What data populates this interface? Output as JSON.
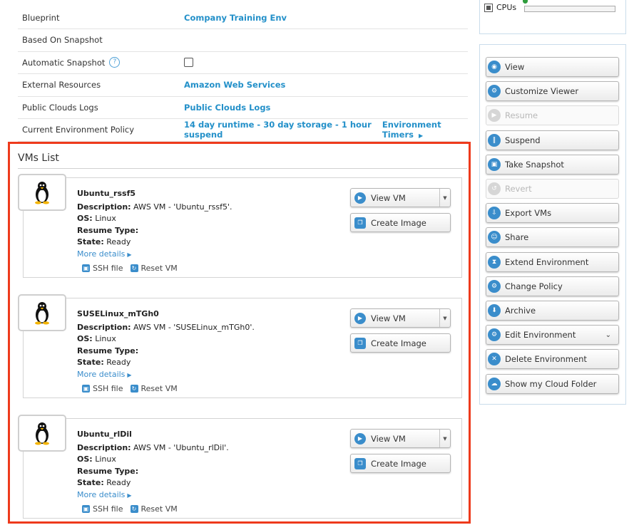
{
  "properties": [
    {
      "label": "Blueprint",
      "value": "Company Training Env"
    },
    {
      "label": "Based On Snapshot",
      "value": ""
    },
    {
      "label": "Automatic Snapshot",
      "value": ""
    },
    {
      "label": "External Resources",
      "value": "Amazon Web Services"
    },
    {
      "label": "Public Clouds Logs",
      "value": "Public Clouds Logs"
    },
    {
      "label": "Current Environment Policy",
      "value": "14 day runtime - 30 day storage - 1 hour suspend",
      "extra": "Environment Timers"
    }
  ],
  "automatic_snapshot_checked": false,
  "vms_list": {
    "title": "VMs List",
    "labels": {
      "description": "Description:",
      "os": "OS:",
      "resume_type": "Resume Type:",
      "state": "State:",
      "more_details": "More details",
      "ssh_file": "SSH file",
      "reset_vm": "Reset VM",
      "view_vm": "View VM",
      "create_image": "Create Image"
    },
    "vms": [
      {
        "name": "Ubuntu_rssf5",
        "description": "AWS VM - 'Ubuntu_rssf5'.",
        "os": "Linux",
        "resume_type": "",
        "state": "Ready"
      },
      {
        "name": "SUSELinux_mTGh0",
        "description": "AWS VM - 'SUSELinux_mTGh0'.",
        "os": "Linux",
        "resume_type": "",
        "state": "Ready"
      },
      {
        "name": "Ubuntu_rlDil",
        "description": "AWS VM - 'Ubuntu_rlDil'.",
        "os": "Linux",
        "resume_type": "",
        "state": "Ready"
      }
    ]
  },
  "cpu": {
    "label": "CPUs"
  },
  "actions": [
    {
      "label": "View",
      "icon": "eye-icon",
      "enabled": true
    },
    {
      "label": "Customize Viewer",
      "icon": "gear-icon",
      "enabled": true
    },
    {
      "label": "Resume",
      "icon": "play-icon",
      "enabled": false
    },
    {
      "label": "Suspend",
      "icon": "pause-icon",
      "enabled": true
    },
    {
      "label": "Take Snapshot",
      "icon": "camera-icon",
      "enabled": true
    },
    {
      "label": "Revert",
      "icon": "revert-icon",
      "enabled": false
    },
    {
      "label": "Export VMs",
      "icon": "export-icon",
      "enabled": true
    },
    {
      "label": "Share",
      "icon": "share-icon",
      "enabled": true
    },
    {
      "label": "Extend Environment",
      "icon": "hourglass-icon",
      "enabled": true
    },
    {
      "label": "Change Policy",
      "icon": "policy-icon",
      "enabled": true
    },
    {
      "label": "Archive",
      "icon": "archive-icon",
      "enabled": true
    },
    {
      "label": "Edit Environment",
      "icon": "edit-gear-icon",
      "enabled": true,
      "dropdown": true
    },
    {
      "label": "Delete Environment",
      "icon": "delete-icon",
      "enabled": true
    },
    {
      "label": "Show my Cloud Folder",
      "icon": "cloud-folder-icon",
      "enabled": true
    }
  ],
  "colors": {
    "link": "#2390c9",
    "highlight_border": "#ee3a1c",
    "icon_blue": "#3a8dcb"
  }
}
